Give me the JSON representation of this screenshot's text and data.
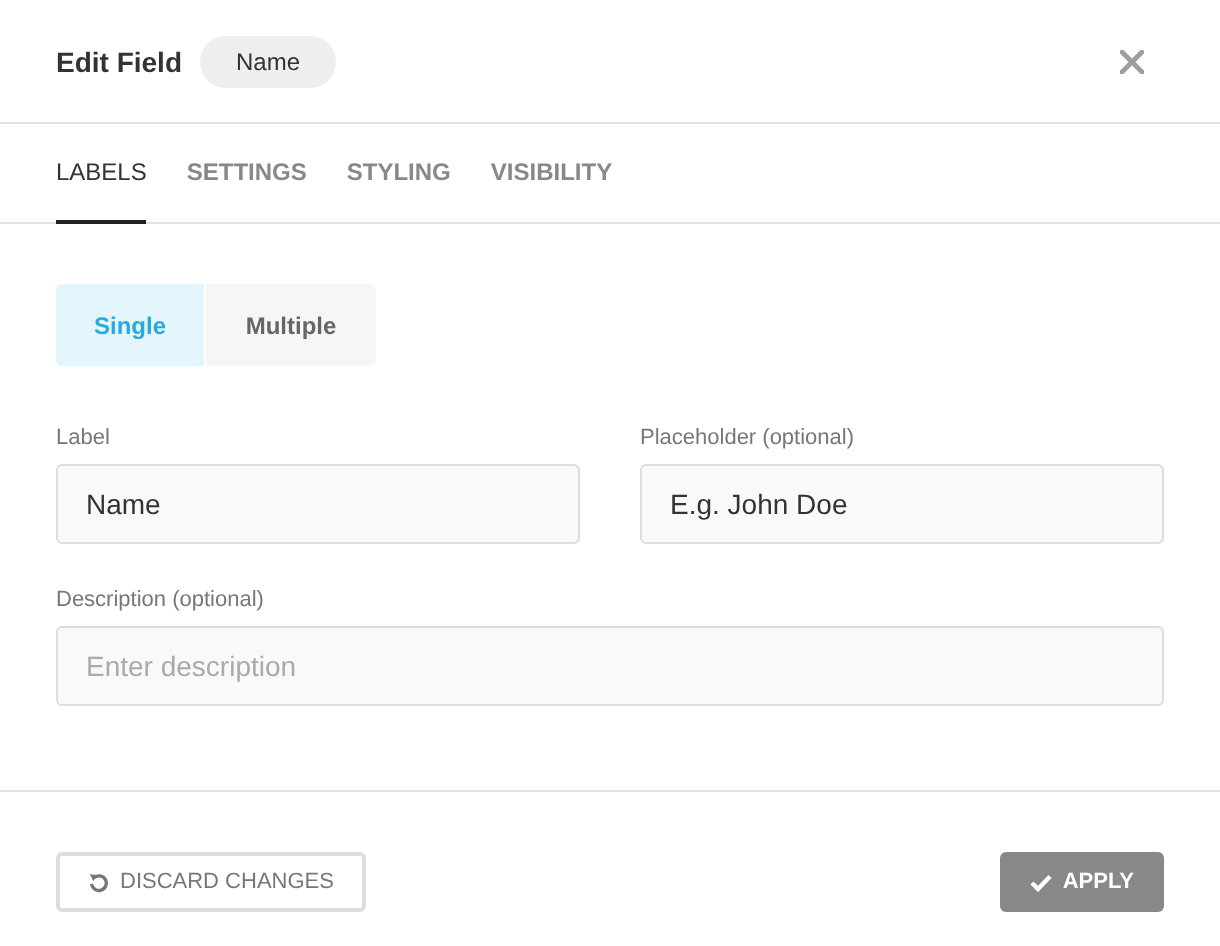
{
  "dialog": {
    "title": "Edit Field",
    "badge": "Name"
  },
  "tabs": [
    {
      "label": "LABELS",
      "selected": true
    },
    {
      "label": "SETTINGS",
      "selected": false
    },
    {
      "label": "STYLING",
      "selected": false
    },
    {
      "label": "VISIBILITY",
      "selected": false
    }
  ],
  "mode_toggle": [
    {
      "label": "Single",
      "selected": true
    },
    {
      "label": "Multiple",
      "selected": false
    }
  ],
  "fields": [
    {
      "label": "Label",
      "value": "Name"
    },
    {
      "label": "Placeholder (optional)",
      "value": "E.g. John Doe"
    },
    {
      "label": "Description (optional)",
      "placeholder": "Enter description"
    }
  ],
  "buttons": {
    "discard": "DISCARD CHANGES",
    "apply": "APPLY"
  }
}
